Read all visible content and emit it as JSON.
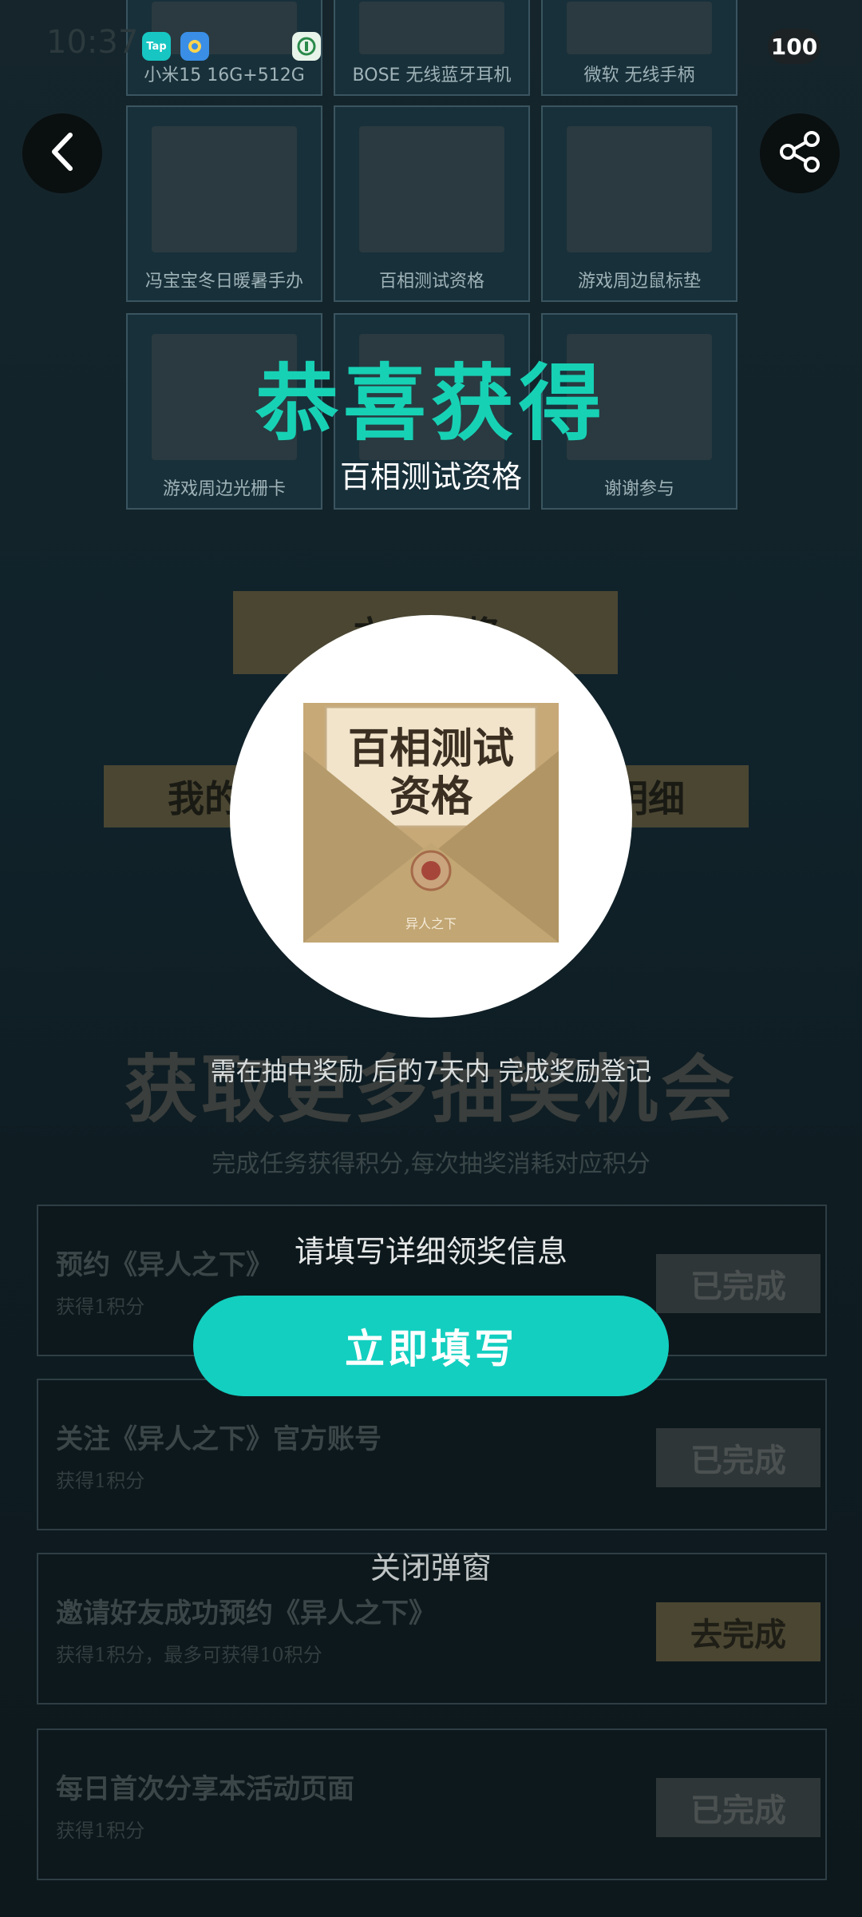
{
  "status_bar": {
    "time": "10:37",
    "battery": "100",
    "app_icons": [
      "Tap"
    ]
  },
  "background": {
    "prizes": [
      "小米15 16G+512G",
      "BOSE 无线蓝牙耳机",
      "微软 无线手柄",
      "冯宝宝冬日暖暑手办",
      "百相测试资格",
      "游戏周边鼠标垫",
      "游戏周边光栅卡",
      "",
      "谢谢参与"
    ],
    "draw_button": "立即抽奖",
    "records_bar": {
      "left": "我的",
      "right": "明细"
    },
    "heading": "获取更多抽奖机会",
    "subheading": "完成任务获得积分,每次抽奖消耗对应积分",
    "tasks": [
      {
        "title": "预约《异人之下》",
        "sub": "获得1积分",
        "button": "已完成"
      },
      {
        "title": "关注《异人之下》官方账号",
        "sub": "获得1积分",
        "button": "已完成"
      },
      {
        "title": "邀请好友成功预约《异人之下》",
        "sub": "获得1积分，最多可获得10积分",
        "button": "去完成"
      },
      {
        "title": "每日首次分享本活动页面",
        "sub": "获得1积分",
        "button": "已完成"
      }
    ]
  },
  "modal": {
    "title": "恭喜获得",
    "prize_name": "百相测试资格",
    "prize_image": {
      "card_text_line1": "百相测试",
      "card_text_line2": "资格",
      "seal_text": "异人之下"
    },
    "note": "需在抽中奖励 后的7天内 完成奖励登记",
    "hint": "请填写详细领奖信息",
    "fill_button": "立即填写",
    "close_link": "关闭弹窗"
  },
  "colors": {
    "accent": "#13cfc0",
    "title": "#17d1b5",
    "envelope": "#b59a6b"
  }
}
